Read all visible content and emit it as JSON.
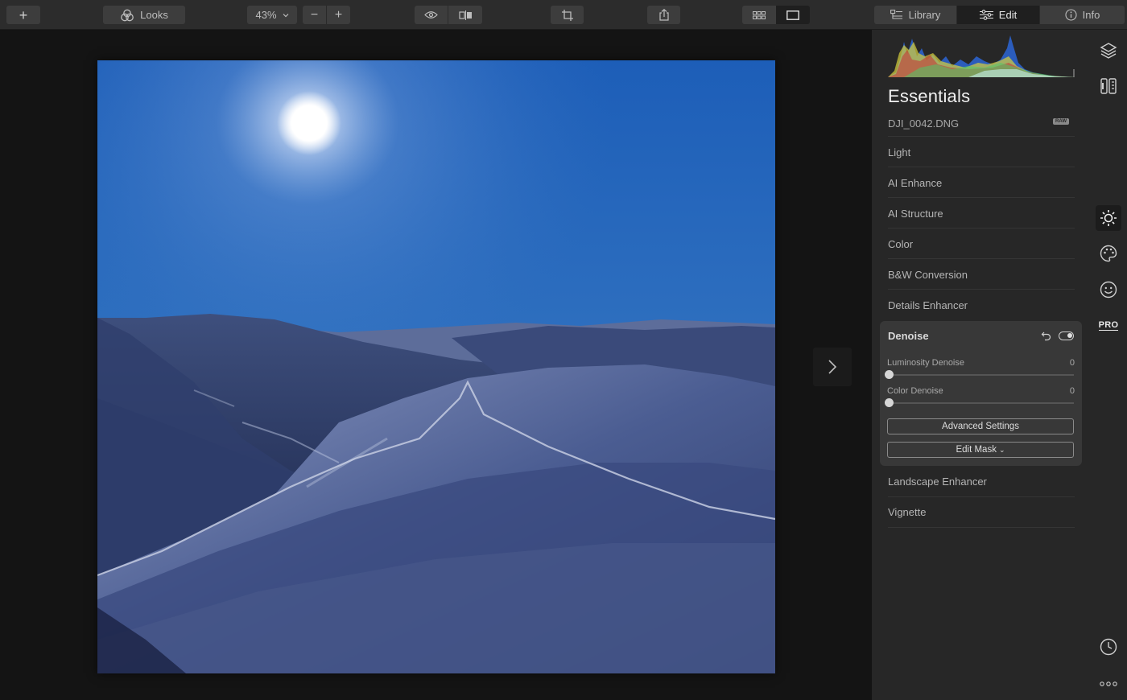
{
  "toolbar": {
    "add_label": "+",
    "looks_label": "Looks",
    "zoom_value": "43%",
    "zoom_out_label": "−",
    "zoom_in_label": "+",
    "tabs": [
      {
        "label": "Library"
      },
      {
        "label": "Edit"
      },
      {
        "label": "Info"
      }
    ]
  },
  "panel": {
    "title": "Essentials",
    "filename": "DJI_0042.DNG",
    "raw_badge": "RAW",
    "sections_top": [
      "Light",
      "AI Enhance",
      "AI Structure",
      "Color",
      "B&W Conversion",
      "Details Enhancer"
    ],
    "denoise": {
      "title": "Denoise",
      "luminosity_label": "Luminosity Denoise",
      "luminosity_value": "0",
      "color_label": "Color Denoise",
      "color_value": "0",
      "advanced_label": "Advanced Settings",
      "mask_label": "Edit Mask",
      "mask_caret": "⌄"
    },
    "sections_bottom": [
      "Landscape Enhancer",
      "Vignette"
    ]
  },
  "rail": {
    "pro_label": "PRO"
  },
  "colors": {
    "toolbar_bg": "#2c2c2c",
    "panel_bg": "#272727",
    "canvas_bg": "#141414",
    "card_bg": "#383838"
  }
}
